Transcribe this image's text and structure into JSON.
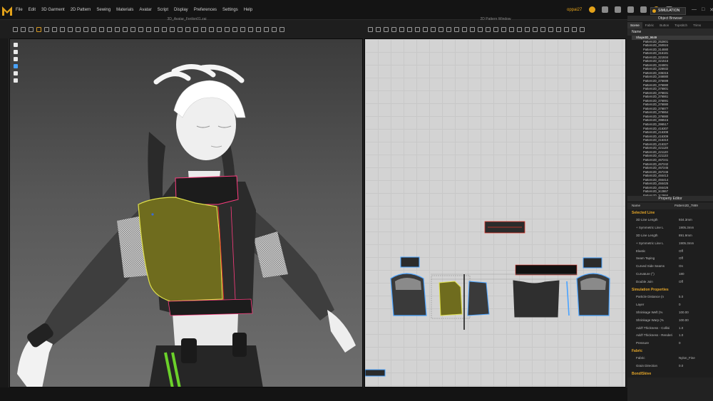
{
  "app": {
    "menu": [
      "File",
      "Edit",
      "3D Garment",
      "2D Pattern",
      "Sewing",
      "Materials",
      "Avatar",
      "Script",
      "Display",
      "Preferences",
      "Settings",
      "Help"
    ],
    "user": "oppai27",
    "simulation_label": "SIMULATION",
    "window_controls": [
      "—",
      "□",
      "✕"
    ]
  },
  "views": {
    "title_3d": "3D_Avatar_Ferilon01.zai",
    "title_2d": "2D Pattern Window"
  },
  "colors": {
    "accent": "#e3a21a",
    "selection_yellow": "#dfe04a",
    "pattern_outline": "#4aa3ff",
    "pattern_fill": "#333333",
    "seam_red": "#e0342a"
  },
  "object_browser": {
    "title": "Object Browser",
    "tabs": [
      "Scene",
      "Fabric",
      "Button",
      "Topstitch",
      "Trims"
    ],
    "header": "Name",
    "shape": "Shape3D_9649",
    "patterns": [
      "Pattern2D_252801",
      "Pattern2D_250924",
      "Pattern2D_314880",
      "Pattern2D_316181",
      "Pattern2D_321934",
      "Pattern2D_321516",
      "Pattern2D_324801",
      "Pattern2D_326932",
      "Pattern2D_336315",
      "Pattern2D_346880",
      "Pattern2D_376699",
      "Pattern2D_376880",
      "Pattern2D_376801",
      "Pattern2D_376831",
      "Pattern2D_376861",
      "Pattern2D_376891",
      "Pattern2D_376880",
      "Pattern2D_376877",
      "Pattern2D_376864",
      "Pattern2D_376880",
      "Pattern2D_396515",
      "Pattern2D_396517",
      "Pattern2D_416307",
      "Pattern2D_416308",
      "Pattern2D_416309",
      "Pattern2D_416310",
      "Pattern2D_416327",
      "Pattern2D_421128",
      "Pattern2D_421120",
      "Pattern2D_421133",
      "Pattern2D_467241",
      "Pattern2D_467242",
      "Pattern2D_467245",
      "Pattern2D_467246",
      "Pattern2D_484413",
      "Pattern2D_484414",
      "Pattern2D_484425",
      "Pattern2D_484426",
      "Pattern2D_3c2867",
      "Pattern2D_3c2868",
      "Pattern2D_3c2869"
    ]
  },
  "property_editor": {
    "title": "Property Editor",
    "name_label": "Name",
    "name_value": "Pattern2D_7889",
    "selected_line_header": "Selected Line",
    "rows": [
      {
        "label": "3D Line Length",
        "value": "934.3mm"
      },
      {
        "label": "+ Symmetric Line L",
        "value": "1905.3mm"
      },
      {
        "label": "3D Line Length",
        "value": "891.9mm"
      },
      {
        "label": "+ Symmetric Line L",
        "value": "1905.3mm"
      },
      {
        "label": "Elastic",
        "value": "Off"
      },
      {
        "label": "Seam Taping",
        "value": "Off"
      },
      {
        "label": "Curved Side Seams",
        "value": "On"
      },
      {
        "label": "Curvature (°)",
        "value": "180"
      },
      {
        "label": "Double Join",
        "value": "Off"
      }
    ],
    "sim_header": "Simulation Properties",
    "sim_rows": [
      {
        "label": "Particle Distance (n",
        "value": "5.0"
      },
      {
        "label": "Layer",
        "value": "0"
      },
      {
        "label": "Shrinkage Weft (%",
        "value": "100.00"
      },
      {
        "label": "Shrinkage Warp (%",
        "value": "100.00"
      },
      {
        "label": "Add'l Thickness - Collisi",
        "value": "1.0"
      },
      {
        "label": "Add'l Thickness - Renderi",
        "value": "1.0"
      },
      {
        "label": "Pressure",
        "value": "0"
      }
    ],
    "fabric_header": "Fabric",
    "fabric_rows": [
      {
        "label": "Fabric",
        "value": "Nylon_Fine"
      },
      {
        "label": "Grain Direction",
        "value": "0.0"
      }
    ],
    "last_header": "Bond/Skive"
  }
}
